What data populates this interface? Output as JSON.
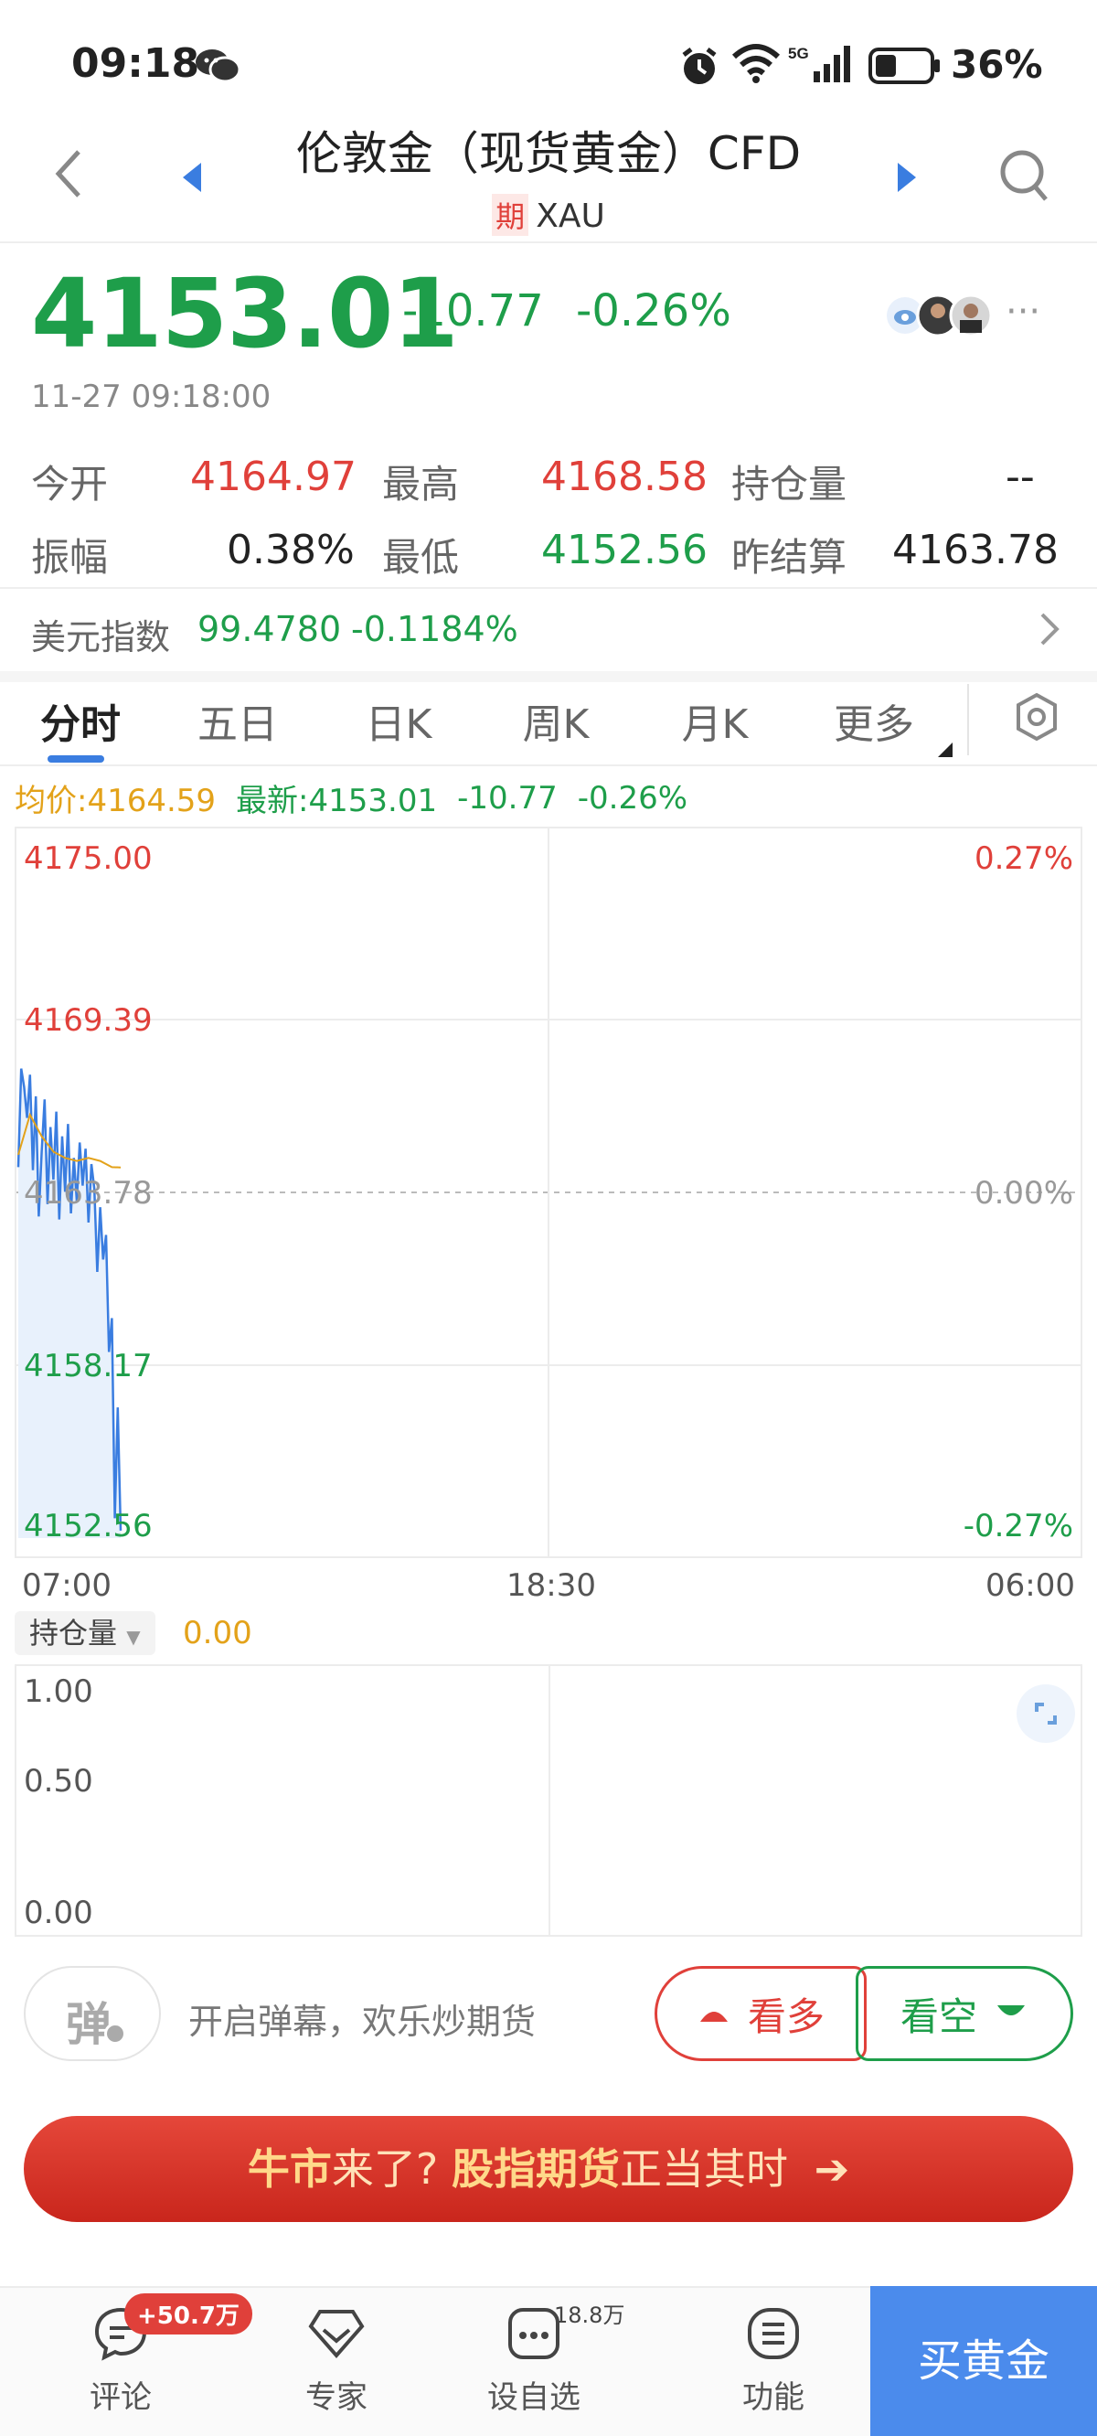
{
  "status_bar": {
    "time": "09:18",
    "network": "5G",
    "battery": "36%"
  },
  "header": {
    "title": "伦敦金（现货黄金）CFD",
    "badge": "期",
    "symbol": "XAU"
  },
  "quote": {
    "price": "4153.01",
    "change": "-10.77",
    "change_pct": "-0.26%",
    "time": "11-27 09:18:00"
  },
  "stats": [
    {
      "label": "今开",
      "value": "4164.97",
      "color": "red"
    },
    {
      "label": "最高",
      "value": "4168.58",
      "color": "red"
    },
    {
      "label": "持仓量",
      "value": "--",
      "color": "dark"
    },
    {
      "label": "振幅",
      "value": "0.38%",
      "color": "dark"
    },
    {
      "label": "最低",
      "value": "4152.56",
      "color": "green"
    },
    {
      "label": "昨结算",
      "value": "4163.78",
      "color": "dark"
    }
  ],
  "dxy": {
    "label": "美元指数",
    "value": "99.4780",
    "change": "-0.1184%"
  },
  "tabs": [
    "分时",
    "五日",
    "日K",
    "周K",
    "月K",
    "更多"
  ],
  "legend": {
    "avg_label": "均价:4164.59",
    "latest_label": "最新:4153.01",
    "change": "-10.77",
    "change_pct": "-0.26%"
  },
  "chart_data": {
    "type": "line",
    "title": "",
    "y_left_ticks": [
      "4175.00",
      "4169.39",
      "4163.78",
      "4158.17",
      "4152.56"
    ],
    "y_right_ticks": [
      "0.27%",
      "0.00%",
      "-0.27%"
    ],
    "x_ticks": [
      "07:00",
      "18:30",
      "06:00"
    ],
    "ylim": [
      4152.56,
      4175.0
    ],
    "prev_settle": 4163.78,
    "series": [
      {
        "x_index": [
          0,
          1,
          2,
          3,
          4,
          5,
          6,
          7,
          8,
          9,
          10,
          11,
          12,
          13,
          14,
          15,
          16,
          17,
          18,
          19,
          20,
          21,
          22,
          23,
          24,
          25,
          26,
          27,
          28,
          29,
          30,
          31,
          32,
          33,
          34,
          35
        ],
        "values": [
          4164.6,
          4167.8,
          4167.2,
          4166.2,
          4167.6,
          4164.5,
          4166.9,
          4163.0,
          4165.1,
          4166.8,
          4163.4,
          4165.9,
          4164.2,
          4166.4,
          4162.9,
          4165.6,
          4163.8,
          4166.0,
          4163.1,
          4164.9,
          4163.5,
          4165.4,
          4164.0,
          4165.2,
          4162.8,
          4164.7,
          4163.9,
          4161.2,
          4163.3,
          4161.6,
          4162.4,
          4158.6,
          4159.7,
          4153.2,
          4156.8,
          4152.8
        ]
      },
      {
        "x_index": [
          0,
          4,
          8,
          12,
          16,
          20,
          24,
          28,
          32,
          35
        ],
        "values": [
          4165.0,
          4166.3,
          4165.6,
          4165.1,
          4164.9,
          4164.8,
          4164.9,
          4164.8,
          4164.6,
          4164.59
        ]
      }
    ],
    "session_minutes": 1380
  },
  "volume": {
    "selector": "持仓量",
    "value": "0.00",
    "y_ticks": [
      "1.00",
      "0.50",
      "0.00"
    ]
  },
  "actions": {
    "danmaku_icon": "弹",
    "danmaku_text": "开启弹幕，欢乐炒期货",
    "bull": "看多",
    "bear": "看空"
  },
  "banner": {
    "part1": "牛市",
    "part2": "来了?",
    "part3": "股指期货",
    "part4": "正当其时"
  },
  "nav": {
    "comment": "评论",
    "comment_badge": "+50.7万",
    "expert": "专家",
    "watch": "设自选",
    "watch_count": "18.8万",
    "functions": "功能",
    "buy": "买黄金"
  },
  "colors": {
    "up": "#e0403a",
    "down": "#1e9e4a",
    "accent": "#4b8bec",
    "avg": "#e3a21a",
    "price_line": "#3a7de0"
  }
}
